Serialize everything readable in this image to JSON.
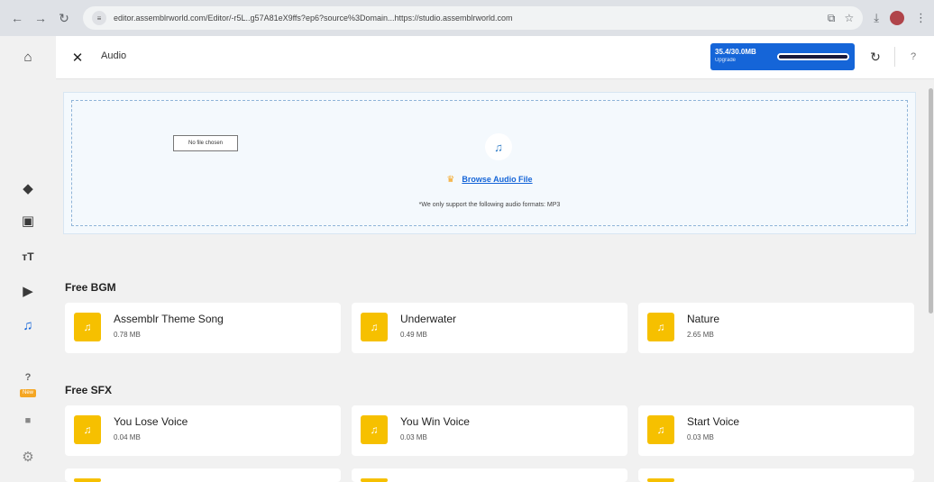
{
  "browser": {
    "url": "editor.assemblrworld.com/Editor/-r5L..g57A81eX9ffs?ep6?source%3Domain...https://studio.assemblrworld.com",
    "site_icon": "tune-icon"
  },
  "sidebar": {
    "items": [
      {
        "name": "home",
        "icon": "home-icon",
        "glyph": "⌂"
      },
      {
        "name": "objects",
        "icon": "cube-icon",
        "glyph": "◆"
      },
      {
        "name": "images",
        "icon": "image-icon",
        "glyph": "▣"
      },
      {
        "name": "text",
        "icon": "text-icon",
        "glyph": "ᴛT"
      },
      {
        "name": "video",
        "icon": "play-icon",
        "glyph": "▶"
      },
      {
        "name": "audio",
        "icon": "music-note-icon",
        "glyph": "♫"
      },
      {
        "name": "help-quiz",
        "icon": "question-icon",
        "glyph": "?"
      },
      {
        "name": "camera",
        "icon": "video-camera-icon",
        "glyph": "■"
      },
      {
        "name": "settings",
        "icon": "gear-icon",
        "glyph": "⚙"
      }
    ],
    "new_badge": "New"
  },
  "topbar": {
    "title": "Audio",
    "storage_amount": "35.4/30.0MB",
    "storage_cta": "Upgrade",
    "storage_fraction": 1.0
  },
  "upload": {
    "file_input_label": "No file chosen",
    "browse_label": "Browse Audio File",
    "support_note": "*We only support the following audio formats: MP3"
  },
  "sections": [
    {
      "title": "Free BGM",
      "items": [
        {
          "name": "Assemblr Theme Song",
          "size": "0.78 MB"
        },
        {
          "name": "Underwater",
          "size": "0.49 MB"
        },
        {
          "name": "Nature",
          "size": "2.65 MB"
        }
      ]
    },
    {
      "title": "Free SFX",
      "items": [
        {
          "name": "You Lose Voice",
          "size": "0.04 MB"
        },
        {
          "name": "You Win Voice",
          "size": "0.03 MB"
        },
        {
          "name": "Start Voice",
          "size": "0.03 MB"
        }
      ]
    }
  ],
  "colors": {
    "accent": "#1565d8",
    "thumb": "#f6c000",
    "crown": "#f5a623"
  }
}
